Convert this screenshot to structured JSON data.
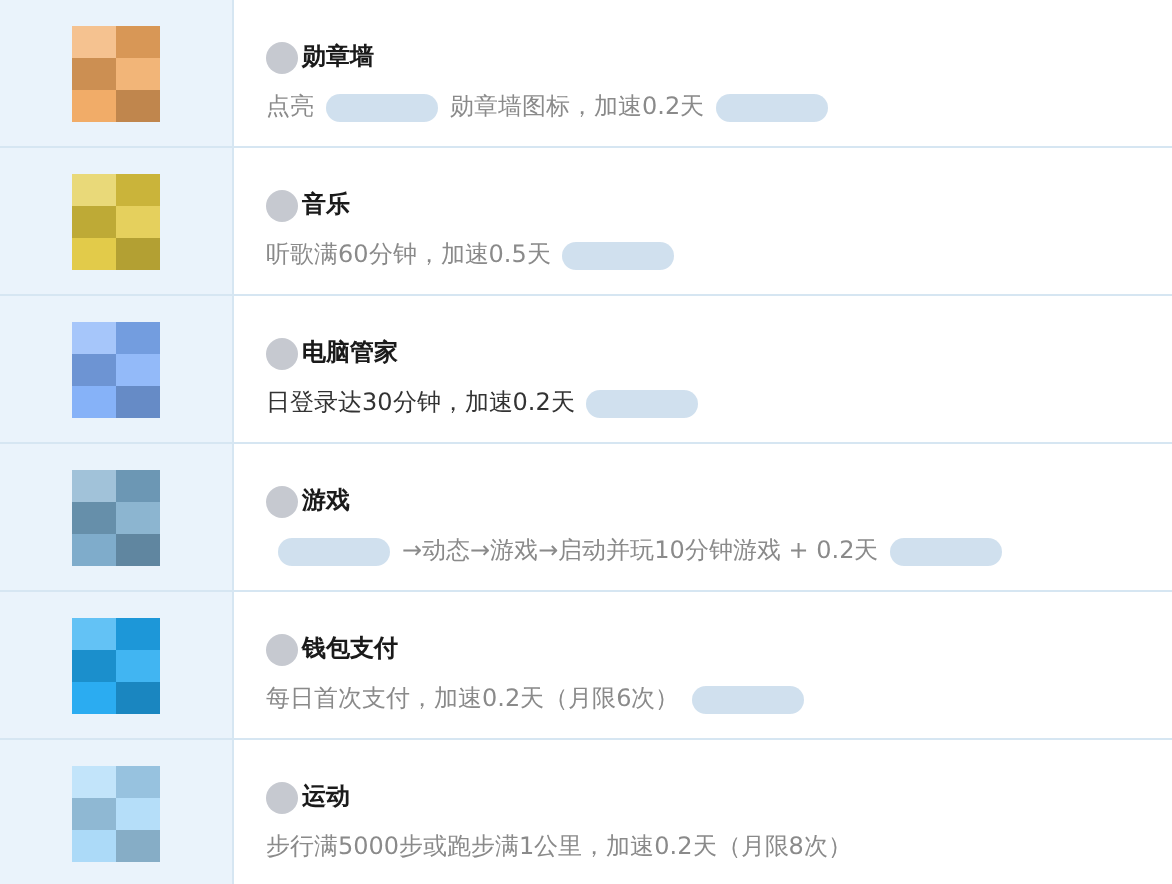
{
  "tasks": [
    {
      "color": "#f0a860",
      "title": "勋章墙",
      "desc": [
        {
          "kind": "text",
          "text": "点亮"
        },
        {
          "kind": "blur"
        },
        {
          "kind": "text",
          "text": "勋章墙图标，加速0.2天"
        },
        {
          "kind": "blur"
        }
      ],
      "dim": true
    },
    {
      "color": "#e0c840",
      "title": "音乐",
      "desc": [
        {
          "kind": "text",
          "text": "听歌满60分钟，加速0.5天"
        },
        {
          "kind": "blur"
        }
      ],
      "dim": true
    },
    {
      "color": "#80aef8",
      "title": "电脑管家",
      "desc": [
        {
          "kind": "text",
          "text": "日登录达30分钟，加速0.2天"
        },
        {
          "kind": "blur"
        }
      ],
      "dim": false
    },
    {
      "color": "#78a8c8",
      "title": "游戏",
      "desc": [
        {
          "kind": "blur"
        },
        {
          "kind": "text",
          "text": "→动态→游戏→启动并玩10分钟游戏  + 0.2天"
        },
        {
          "kind": "blur"
        }
      ],
      "dim": true
    },
    {
      "color": "#20a8f0",
      "title": "钱包支付",
      "desc": [
        {
          "kind": "text",
          "text": "每日首次支付，加速0.2天（月限6次）"
        },
        {
          "kind": "blur"
        }
      ],
      "dim": true
    },
    {
      "color": "#a8d8f8",
      "title": "运动",
      "desc": [
        {
          "kind": "text",
          "text": "步行满5000步或跑步满1公里，加速0.2天（月限8次）"
        }
      ],
      "dim": true
    }
  ]
}
